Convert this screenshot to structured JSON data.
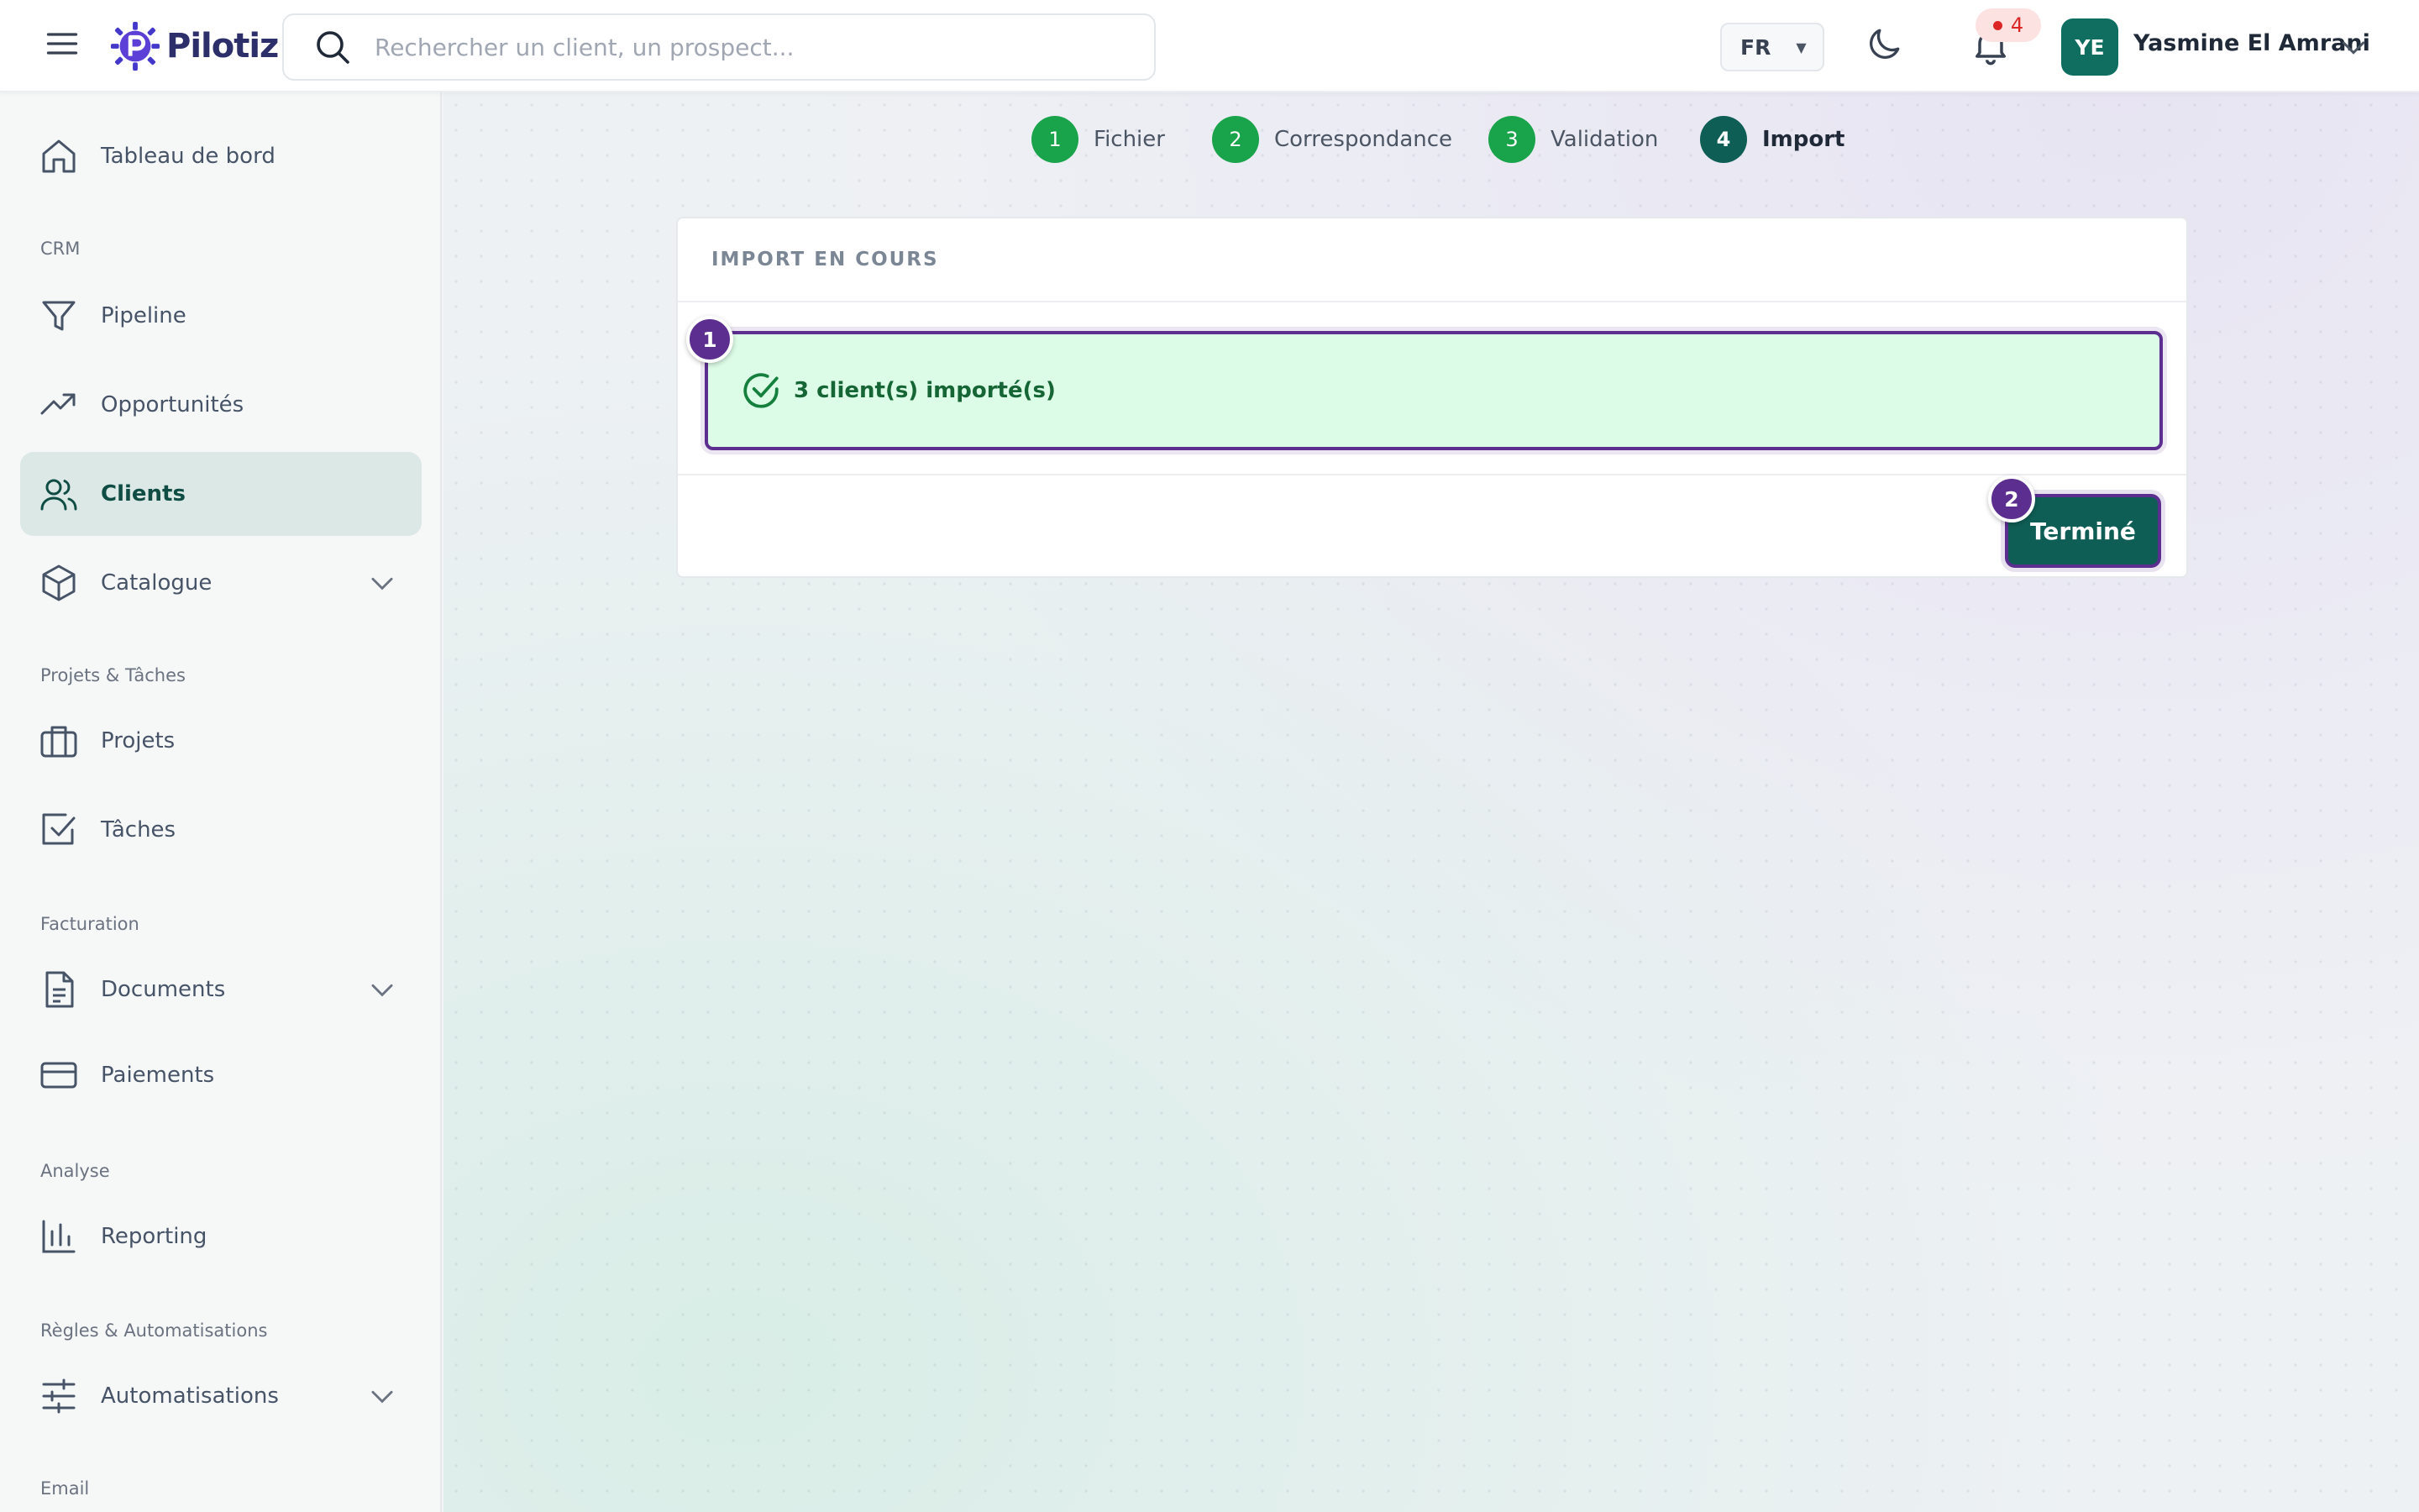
{
  "header": {
    "brand": "Pilotiz",
    "search_placeholder": "Rechercher un client, un prospect...",
    "language": "FR",
    "notification_count": "4",
    "user_initials": "YE",
    "user_name": "Yasmine El Amrani"
  },
  "sidebar": {
    "dashboard": "Tableau de bord",
    "section_crm": "CRM",
    "pipeline": "Pipeline",
    "opportunities": "Opportunités",
    "clients": "Clients",
    "catalogue": "Catalogue",
    "section_projects": "Projets & Tâches",
    "projects": "Projets",
    "tasks": "Tâches",
    "section_billing": "Facturation",
    "documents": "Documents",
    "payments": "Paiements",
    "section_analysis": "Analyse",
    "reporting": "Reporting",
    "section_rules": "Règles & Automatisations",
    "automations": "Automatisations",
    "section_email": "Email"
  },
  "stepper": {
    "steps": [
      {
        "number": "1",
        "label": "Fichier"
      },
      {
        "number": "2",
        "label": "Correspondance"
      },
      {
        "number": "3",
        "label": "Validation"
      },
      {
        "number": "4",
        "label": "Import"
      }
    ]
  },
  "import_card": {
    "title": "IMPORT EN COURS",
    "success_message": "3 client(s) importé(s)",
    "done_label": "Terminé"
  },
  "markers": {
    "first": "1",
    "second": "2"
  },
  "colors": {
    "brand": "#0f5e55",
    "step_done": "#19a34a",
    "success_bg": "#dcfce7",
    "highlight": "#5b2e8f"
  }
}
